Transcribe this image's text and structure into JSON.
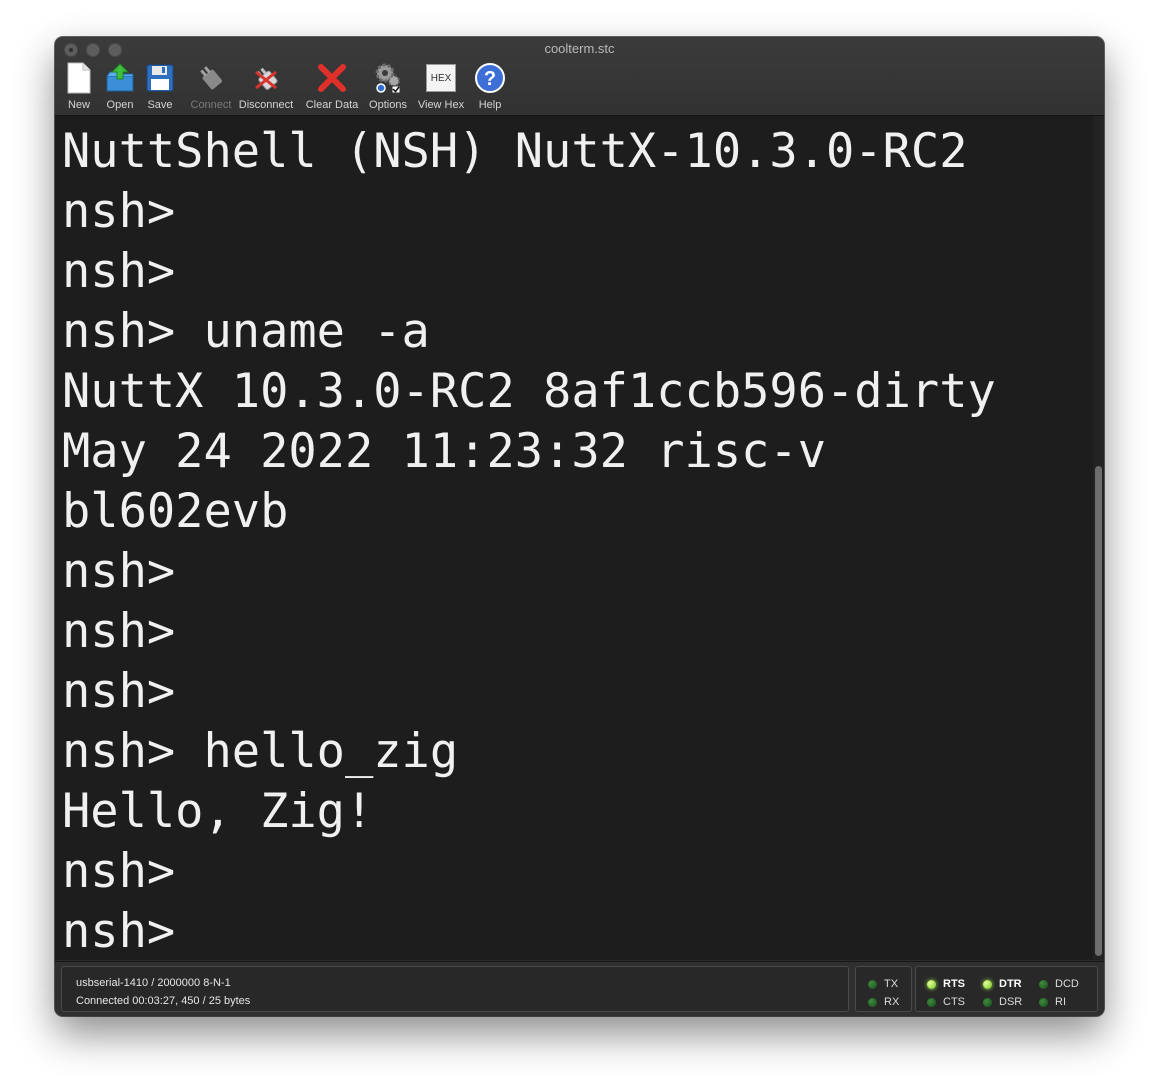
{
  "window": {
    "title": "coolterm.stc"
  },
  "toolbar": {
    "items": [
      {
        "label": "New",
        "icon": "new-document-icon",
        "enabled": true
      },
      {
        "label": "Open",
        "icon": "open-folder-icon",
        "enabled": true
      },
      {
        "label": "Save",
        "icon": "floppy-disk-icon",
        "enabled": true
      },
      {
        "label": "Connect",
        "icon": "plug-connect-icon",
        "enabled": false
      },
      {
        "label": "Disconnect",
        "icon": "plug-disconnect-icon",
        "enabled": true
      },
      {
        "label": "Clear Data",
        "icon": "red-x-icon",
        "enabled": true
      },
      {
        "label": "Options",
        "icon": "gears-icon",
        "enabled": true
      },
      {
        "label": "View Hex",
        "icon": "hex-icon",
        "enabled": true
      },
      {
        "label": "Help",
        "icon": "help-question-icon",
        "enabled": true
      }
    ],
    "hex_icon_text": "HEX"
  },
  "terminal": {
    "lines": [
      "NuttShell (NSH) NuttX-10.3.0-RC2",
      "nsh>",
      "nsh>",
      "nsh> uname -a",
      "NuttX 10.3.0-RC2 8af1ccb596-dirty",
      "May 24 2022 11:23:32 risc-v",
      "bl602evb",
      "nsh>",
      "nsh>",
      "nsh>",
      "nsh> hello_zig",
      "Hello, Zig!",
      "nsh>",
      "nsh>"
    ]
  },
  "status": {
    "port_info": "usbserial-1410 / 2000000 8-N-1",
    "connection_info": "Connected 00:03:27, 450 / 25 bytes",
    "leds": {
      "TX": {
        "label": "TX",
        "on": false
      },
      "RX": {
        "label": "RX",
        "on": false
      },
      "RTS": {
        "label": "RTS",
        "on": true
      },
      "CTS": {
        "label": "CTS",
        "on": false
      },
      "DTR": {
        "label": "DTR",
        "on": true
      },
      "DSR": {
        "label": "DSR",
        "on": false
      },
      "DCD": {
        "label": "DCD",
        "on": false
      },
      "RI": {
        "label": "RI",
        "on": false
      }
    }
  }
}
